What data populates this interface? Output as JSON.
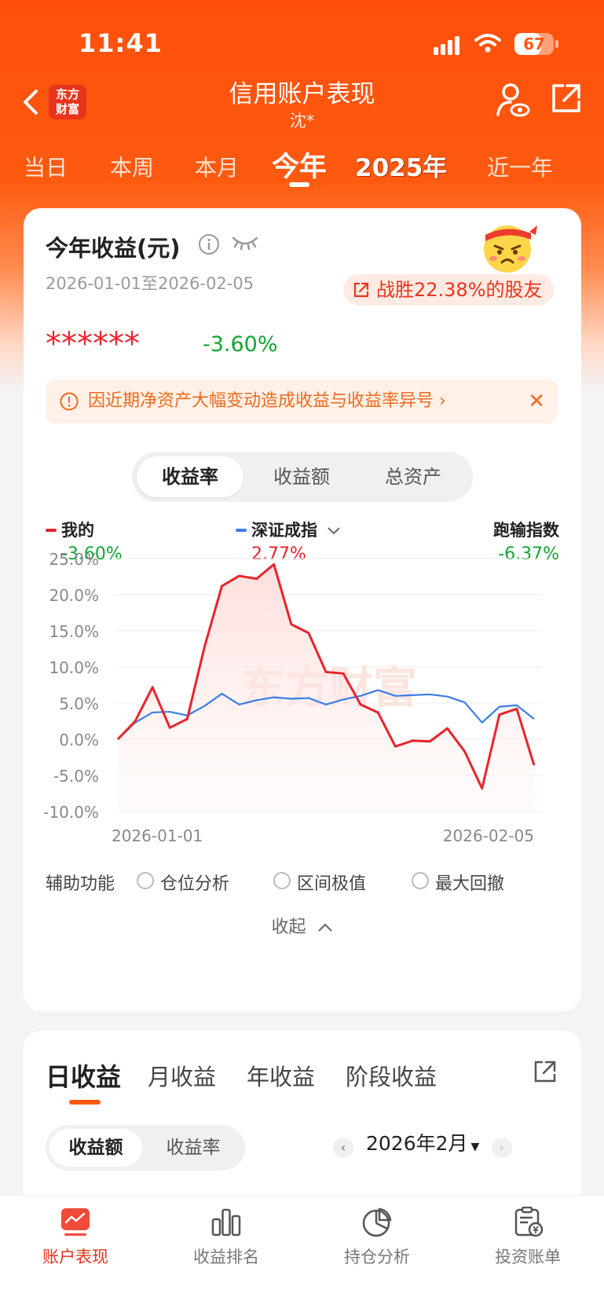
{
  "status_bar": {
    "time": "11:41",
    "battery": "67",
    "battery_level": 0.67
  },
  "header": {
    "logo_text": "东方\n财富",
    "title": "信用账户表现",
    "subtitle": "沈*"
  },
  "period_tabs": [
    {
      "label": "当日"
    },
    {
      "label": "本周"
    },
    {
      "label": "本月"
    },
    {
      "label": "今年",
      "active": true
    },
    {
      "label": "2025年"
    },
    {
      "label": "近一年"
    }
  ],
  "summary": {
    "title": "今年收益(元)",
    "date_range": "2026-01-01至2026-02-05",
    "beat_text": "战胜22.38%的股友",
    "hidden_amount": "******",
    "return_pct": "-3.60%",
    "notice": "因近期净资产大幅变动造成收益与收益率异号 ›",
    "notice_close": "✕"
  },
  "segment": {
    "options": [
      "收益率",
      "收益额",
      "总资产"
    ],
    "active": 0
  },
  "legend": {
    "mine": {
      "name": "我的",
      "value": "-3.60%",
      "color": "#e8242c"
    },
    "index": {
      "name": "深证成指",
      "value": "2.77%",
      "color": "#3b7de8"
    },
    "beat": {
      "name": "跑输指数",
      "value": "-6.37%"
    }
  },
  "watermark": "东方财富",
  "chart_data": {
    "type": "line",
    "x_start": "2026-01-01",
    "x_end": "2026-02-05",
    "y_ticks": [
      "25.0%",
      "20.0%",
      "15.0%",
      "10.0%",
      "5.0%",
      "0.0%",
      "-5.0%",
      "-10.0%"
    ],
    "ylim": [
      -10,
      25
    ],
    "series": [
      {
        "name": "我的",
        "color": "#e8242c",
        "values": [
          0,
          2.5,
          7.2,
          1.6,
          2.8,
          12.8,
          21.2,
          22.6,
          22.2,
          24.2,
          15.9,
          14.7,
          9.3,
          9.1,
          4.8,
          3.7,
          -1.0,
          -0.2,
          -0.3,
          1.5,
          -1.7,
          -6.8,
          3.4,
          4.2,
          -3.6
        ]
      },
      {
        "name": "深证成指",
        "color": "#3b7de8",
        "values": [
          0,
          2.3,
          3.7,
          3.8,
          3.3,
          4.6,
          6.3,
          4.8,
          5.4,
          5.8,
          5.6,
          5.7,
          4.8,
          5.5,
          6.0,
          6.8,
          6.0,
          6.1,
          6.2,
          5.9,
          5.1,
          2.3,
          4.5,
          4.7,
          2.8
        ]
      }
    ]
  },
  "aux": {
    "label": "辅助功能",
    "options": [
      "仓位分析",
      "区间极值",
      "最大回撤"
    ],
    "collapse": "收起"
  },
  "daily": {
    "tabs": [
      "日收益",
      "月收益",
      "年收益",
      "阶段收益"
    ],
    "active": 0,
    "seg": [
      "收益额",
      "收益率"
    ],
    "month": "2026年2月"
  },
  "bottom_nav": [
    {
      "label": "账户表现",
      "icon": "chart-icon",
      "active": true
    },
    {
      "label": "收益排名",
      "icon": "bar-icon"
    },
    {
      "label": "持仓分析",
      "icon": "pie-icon"
    },
    {
      "label": "投资账单",
      "icon": "bill-icon"
    }
  ]
}
